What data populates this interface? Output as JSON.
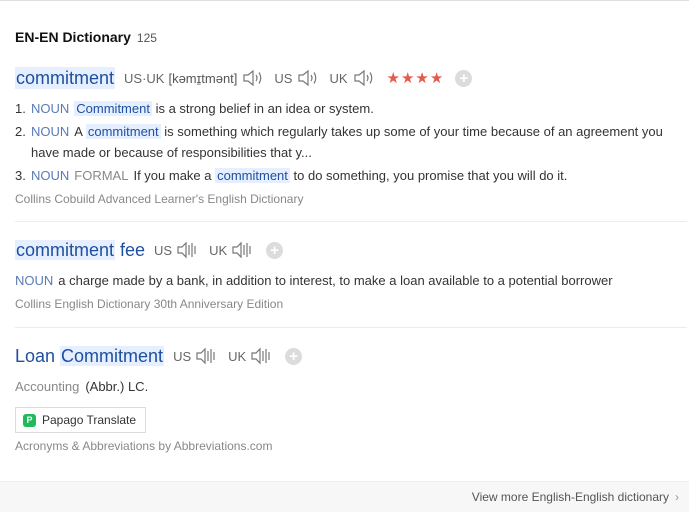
{
  "header": {
    "title": "EN-EN Dictionary",
    "count": "125"
  },
  "entries": [
    {
      "headword": "commitment",
      "pron_label_usuk": "US·UK",
      "phonetic": "[kəmɪ̱tmənt]",
      "pron_label_us": "US",
      "pron_label_uk": "UK",
      "stars": "★★★★",
      "star_count": 4,
      "defs": [
        {
          "num": "1.",
          "pos": "NOUN",
          "pre": "",
          "kw": "Commitment",
          "post": " is a strong belief in an idea or system."
        },
        {
          "num": "2.",
          "pos": "NOUN",
          "pre": "A ",
          "kw": "commitment",
          "post": " is something which regularly takes up some of your time because of an agreement you have made or because of responsibilities that y..."
        },
        {
          "num": "3.",
          "pos": "NOUN",
          "register": "FORMAL",
          "pre": "If you make a ",
          "kw": "commitment",
          "post": " to do something, you promise that you will do it."
        }
      ],
      "source": "Collins Cobuild Advanced Learner's English Dictionary"
    },
    {
      "headword_hl": "commitment",
      "headword_rest": " fee",
      "pron_label_us": "US",
      "pron_label_uk": "UK",
      "pos": "NOUN",
      "definition": "a charge made by a bank, in addition to interest, to make a loan available to a potential borrower",
      "source": "Collins English Dictionary 30th Anniversary Edition"
    },
    {
      "headword_pre": "Loan ",
      "headword_hl": "Commitment",
      "pron_label_us": "US",
      "pron_label_uk": "UK",
      "category": "Accounting",
      "definition": "(Abbr.) LC.",
      "papago_label": "Papago Translate",
      "source": "Acronyms & Abbreviations by Abbreviations.com"
    }
  ],
  "footer": {
    "more_label": "View more English-English dictionary"
  },
  "colors": {
    "link": "#1e4fa0",
    "highlight": "#e5efff",
    "pos": "#5a7ab7",
    "stars": "#e35b4b",
    "papago": "#1fba5c"
  },
  "icons": {
    "speaker": "speaker-icon",
    "add": "plus-icon",
    "chevron": "chevron-right-icon"
  }
}
